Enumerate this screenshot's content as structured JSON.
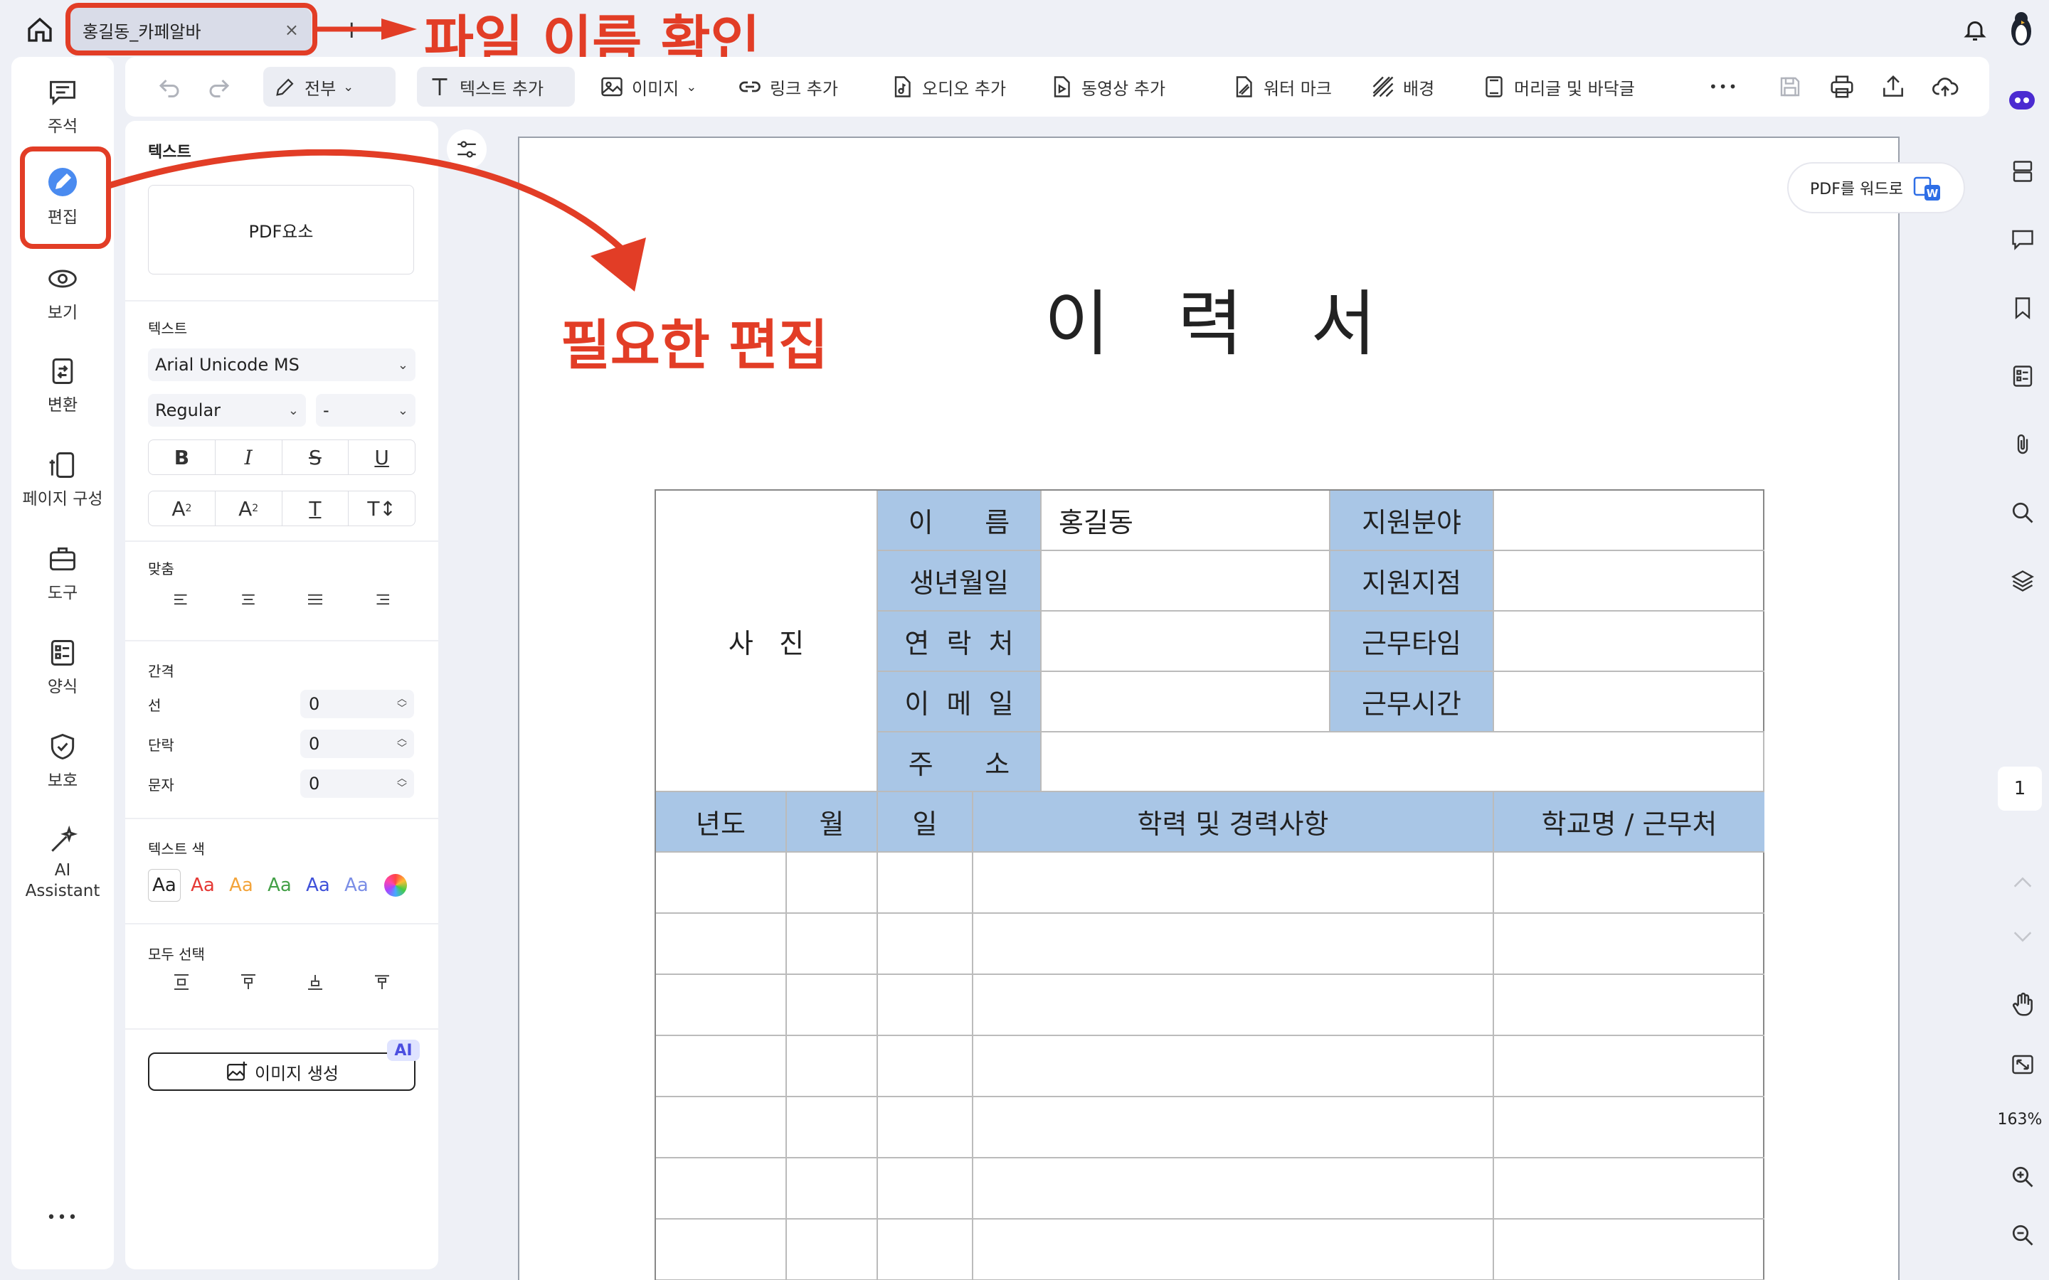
{
  "tab": {
    "title": "홍길동_카페알바",
    "close": "×"
  },
  "annotations": {
    "filename_note": "파일 이름 확인",
    "edit_note": "필요한 편집"
  },
  "leftnav": [
    {
      "label": "주석",
      "icon": "comment-icon"
    },
    {
      "label": "편집",
      "icon": "edit-icon"
    },
    {
      "label": "보기",
      "icon": "eye-icon"
    },
    {
      "label": "변환",
      "icon": "convert-icon"
    },
    {
      "label": "페이지 구성",
      "icon": "page-organize-icon"
    },
    {
      "label": "도구",
      "icon": "toolbox-icon"
    },
    {
      "label": "양식",
      "icon": "form-icon"
    },
    {
      "label": "보호",
      "icon": "shield-icon"
    },
    {
      "label": "AI Assistant",
      "icon": "ai-wand-icon"
    }
  ],
  "toolbar": {
    "all": "전부",
    "add_text": "텍스트 추가",
    "image": "이미지",
    "add_link": "링크 추가",
    "add_audio": "오디오 추가",
    "add_video": "동영상 추가",
    "watermark": "워터 마크",
    "background": "배경",
    "header_footer": "머리글 및 바닥글",
    "more": "•••"
  },
  "panel": {
    "section_text": "텍스트",
    "pdf_element": "PDF요소",
    "text_label": "텍스트",
    "font": "Arial Unicode MS",
    "style": "Regular",
    "size": "-",
    "bold": "B",
    "italic": "I",
    "strike": "S",
    "underline": "U",
    "align_label": "맞춤",
    "spacing_label": "간격",
    "line_label": "선",
    "line_value": "0",
    "para_label": "단락",
    "para_value": "0",
    "char_label": "문자",
    "char_value": "0",
    "color_label": "텍스트 색",
    "swatch_text": "Aa",
    "swatch_colors": [
      "#222222",
      "#e53935",
      "#f3a43b",
      "#43a047",
      "#3f51d9",
      "#7b8ee6"
    ],
    "select_all_label": "모두 선택",
    "gen_image": "이미지 생성",
    "ai_badge": "AI"
  },
  "document": {
    "pdf_to_word": "PDF를 워드로",
    "title": "이   력   서",
    "photo": "사   진",
    "labels": [
      "이      름",
      "생년월일",
      "연  락  처",
      "이  메  일",
      "주      소"
    ],
    "name_value": "홍길동",
    "right_labels": [
      "지원분야",
      "지원지점",
      "근무타임",
      "근무시간"
    ],
    "history_headers": [
      "년도",
      "월",
      "일",
      "학력 및 경력사항",
      "학교명 / 근무처"
    ]
  },
  "rightbar": {
    "page": "1",
    "zoom": "163%"
  }
}
